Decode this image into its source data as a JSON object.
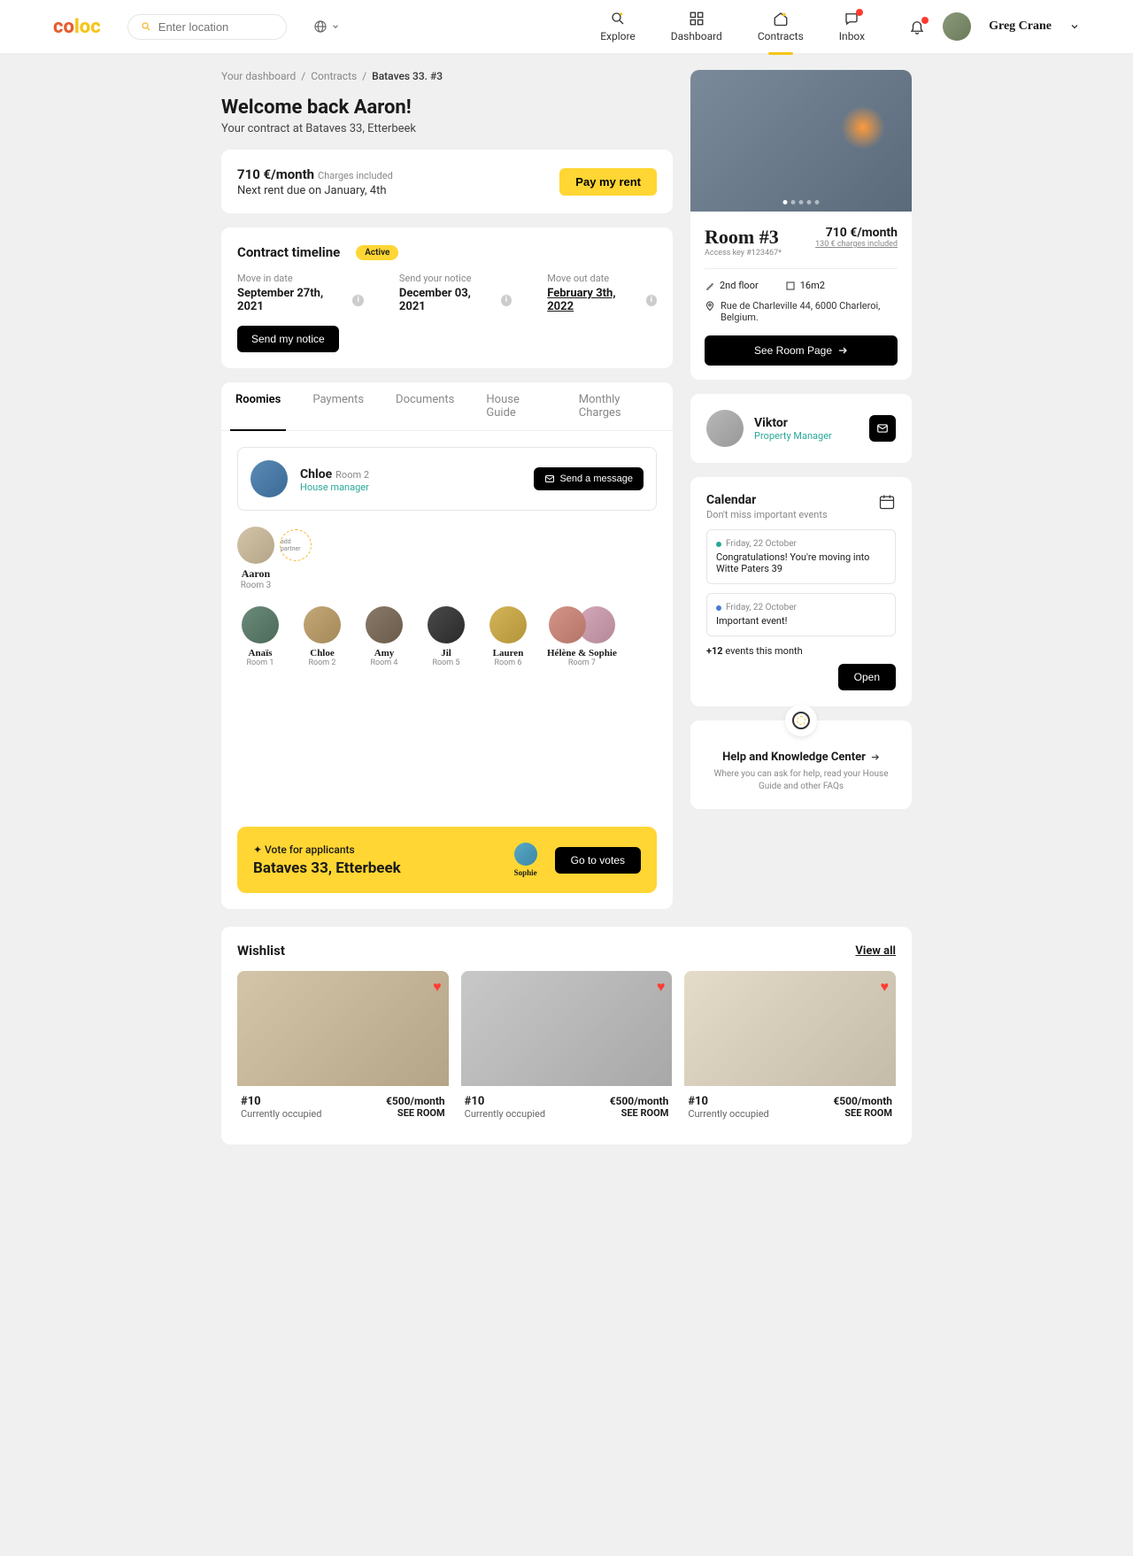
{
  "header": {
    "logo": "coloc",
    "search_placeholder": "Enter location",
    "nav": [
      {
        "label": "Explore"
      },
      {
        "label": "Dashboard"
      },
      {
        "label": "Contracts"
      },
      {
        "label": "Inbox"
      }
    ],
    "username": "Greg Crane"
  },
  "breadcrumb": {
    "dashboard": "Your dashboard",
    "contracts": "Contracts",
    "current": "Bataves 33. #3"
  },
  "welcome": {
    "title": "Welcome back Aaron!",
    "subtitle": "Your contract at Bataves 33, Etterbeek"
  },
  "rent": {
    "price": "710 €/month",
    "charges": "Charges included",
    "due": "Next rent due on January, 4th",
    "button": "Pay my rent"
  },
  "timeline": {
    "title": "Contract timeline",
    "badge": "Active",
    "items": [
      {
        "label": "Move in date",
        "date": "September 27th, 2021"
      },
      {
        "label": "Send your notice",
        "date": "December 03, 2021"
      },
      {
        "label": "Move out date",
        "date": "February 3th, 2022"
      }
    ],
    "button": "Send my notice"
  },
  "tabs": [
    "Roomies",
    "Payments",
    "Documents",
    "House Guide",
    "Monthly Charges"
  ],
  "manager": {
    "name": "Chloe",
    "room": "Room 2",
    "role": "House manager",
    "button": "Send a message"
  },
  "partner": {
    "add": "add partner",
    "name": "Aaron",
    "room": "Room 3"
  },
  "roomies": [
    {
      "name": "Anaïs",
      "room": "Room 1"
    },
    {
      "name": "Chloe",
      "room": "Room 2"
    },
    {
      "name": "Amy",
      "room": "Room 4"
    },
    {
      "name": "Jil",
      "room": "Room 5"
    },
    {
      "name": "Lauren",
      "room": "Room 6"
    },
    {
      "name": "Hélène & Sophie",
      "room": "Room 7"
    }
  ],
  "vote": {
    "tag": "Vote for applicants",
    "address": "Bataves 33, Etterbeek",
    "applicant": "Sophie",
    "button": "Go to votes"
  },
  "room": {
    "title": "Room #3",
    "key": "Access key #123467*",
    "price": "710 €/month",
    "charges": "130 € charges included",
    "floor": "2nd floor",
    "area": "16m2",
    "address": "Rue de Charleville 44, 6000 Charleroi, Belgium.",
    "button": "See Room Page"
  },
  "viktor": {
    "name": "Viktor",
    "role": "Property Manager"
  },
  "calendar": {
    "title": "Calendar",
    "subtitle": "Don't miss important events",
    "events": [
      {
        "date": "Friday, 22 October",
        "text": "Congratulations! You're moving into Witte Paters 39"
      },
      {
        "date": "Friday, 22 October",
        "text": "Important event!"
      }
    ],
    "more_count": "+12",
    "more_text": "events this month",
    "button": "Open"
  },
  "help": {
    "title": "Help and Knowledge Center",
    "text": "Where you can ask for help, read your House Guide and other FAQs"
  },
  "wishlist": {
    "title": "Wishlist",
    "viewall": "View all",
    "items": [
      {
        "num": "#10",
        "status": "Currently occupied",
        "price": "€500/month",
        "see": "SEE ROOM"
      },
      {
        "num": "#10",
        "status": "Currently occupied",
        "price": "€500/month",
        "see": "SEE ROOM"
      },
      {
        "num": "#10",
        "status": "Currently occupied",
        "price": "€500/month",
        "see": "SEE ROOM"
      }
    ]
  }
}
